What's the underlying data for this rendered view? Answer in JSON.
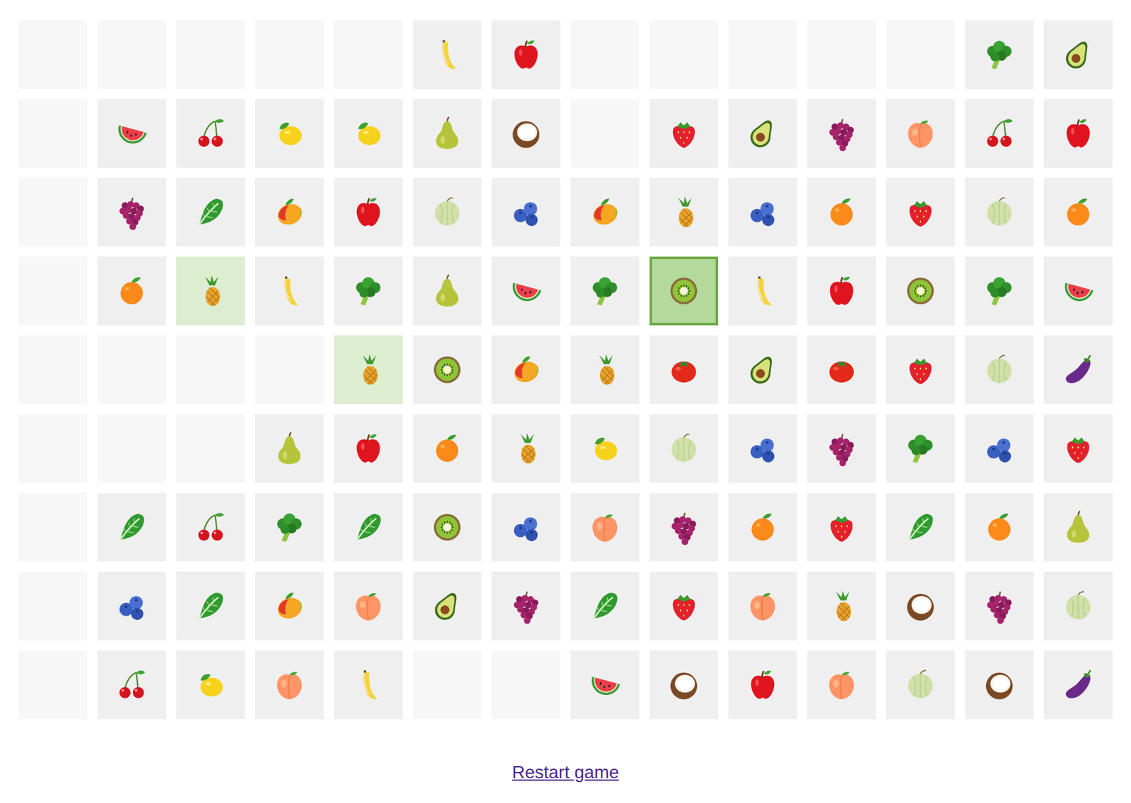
{
  "board": {
    "rows": [
      {
        "cells": [
          {
            "kind": "empty",
            "selected": false,
            "highlighted": false
          },
          {
            "kind": "empty",
            "selected": false,
            "highlighted": false
          },
          {
            "kind": "empty",
            "selected": false,
            "highlighted": false
          },
          {
            "kind": "empty",
            "selected": false,
            "highlighted": false
          },
          {
            "kind": "empty",
            "selected": false,
            "highlighted": false
          },
          {
            "kind": "banana",
            "selected": false,
            "highlighted": false
          },
          {
            "kind": "apple",
            "selected": false,
            "highlighted": false
          },
          {
            "kind": "empty",
            "selected": false,
            "highlighted": false
          },
          {
            "kind": "empty",
            "selected": false,
            "highlighted": false
          },
          {
            "kind": "empty",
            "selected": false,
            "highlighted": false
          },
          {
            "kind": "empty",
            "selected": false,
            "highlighted": false
          },
          {
            "kind": "empty",
            "selected": false,
            "highlighted": false
          },
          {
            "kind": "broccoli",
            "selected": false,
            "highlighted": false
          },
          {
            "kind": "avocado",
            "selected": false,
            "highlighted": false
          }
        ]
      },
      {
        "cells": [
          {
            "kind": "empty",
            "selected": false,
            "highlighted": false
          },
          {
            "kind": "watermelon",
            "selected": false,
            "highlighted": false
          },
          {
            "kind": "cherry",
            "selected": false,
            "highlighted": false
          },
          {
            "kind": "lemon",
            "selected": false,
            "highlighted": false
          },
          {
            "kind": "lemon",
            "selected": false,
            "highlighted": false
          },
          {
            "kind": "pear",
            "selected": false,
            "highlighted": false
          },
          {
            "kind": "coconut",
            "selected": false,
            "highlighted": false
          },
          {
            "kind": "empty",
            "selected": false,
            "highlighted": false
          },
          {
            "kind": "strawberry",
            "selected": false,
            "highlighted": false
          },
          {
            "kind": "avocado",
            "selected": false,
            "highlighted": false
          },
          {
            "kind": "grapes",
            "selected": false,
            "highlighted": false
          },
          {
            "kind": "peach",
            "selected": false,
            "highlighted": false
          },
          {
            "kind": "cherry",
            "selected": false,
            "highlighted": false
          },
          {
            "kind": "apple",
            "selected": false,
            "highlighted": false
          }
        ]
      },
      {
        "cells": [
          {
            "kind": "empty",
            "selected": false,
            "highlighted": false
          },
          {
            "kind": "grapes",
            "selected": false,
            "highlighted": false
          },
          {
            "kind": "lettuce",
            "selected": false,
            "highlighted": false
          },
          {
            "kind": "mango",
            "selected": false,
            "highlighted": false
          },
          {
            "kind": "apple",
            "selected": false,
            "highlighted": false
          },
          {
            "kind": "melon",
            "selected": false,
            "highlighted": false
          },
          {
            "kind": "blueberry",
            "selected": false,
            "highlighted": false
          },
          {
            "kind": "mango",
            "selected": false,
            "highlighted": false
          },
          {
            "kind": "pineapple",
            "selected": false,
            "highlighted": false
          },
          {
            "kind": "blueberry",
            "selected": false,
            "highlighted": false
          },
          {
            "kind": "orange",
            "selected": false,
            "highlighted": false
          },
          {
            "kind": "strawberry",
            "selected": false,
            "highlighted": false
          },
          {
            "kind": "melon",
            "selected": false,
            "highlighted": false
          },
          {
            "kind": "orange",
            "selected": false,
            "highlighted": false
          }
        ]
      },
      {
        "cells": [
          {
            "kind": "empty",
            "selected": false,
            "highlighted": false
          },
          {
            "kind": "orange",
            "selected": false,
            "highlighted": false
          },
          {
            "kind": "pineapple",
            "selected": false,
            "highlighted": true
          },
          {
            "kind": "banana",
            "selected": false,
            "highlighted": false
          },
          {
            "kind": "broccoli",
            "selected": false,
            "highlighted": false
          },
          {
            "kind": "pear",
            "selected": false,
            "highlighted": false
          },
          {
            "kind": "watermelon",
            "selected": false,
            "highlighted": false
          },
          {
            "kind": "broccoli",
            "selected": false,
            "highlighted": false
          },
          {
            "kind": "kiwi",
            "selected": true,
            "highlighted": false
          },
          {
            "kind": "banana",
            "selected": false,
            "highlighted": false
          },
          {
            "kind": "apple",
            "selected": false,
            "highlighted": false
          },
          {
            "kind": "kiwi",
            "selected": false,
            "highlighted": false
          },
          {
            "kind": "broccoli",
            "selected": false,
            "highlighted": false
          },
          {
            "kind": "watermelon",
            "selected": false,
            "highlighted": false
          }
        ]
      },
      {
        "cells": [
          {
            "kind": "empty",
            "selected": false,
            "highlighted": false
          },
          {
            "kind": "empty",
            "selected": false,
            "highlighted": false
          },
          {
            "kind": "empty",
            "selected": false,
            "highlighted": false
          },
          {
            "kind": "empty",
            "selected": false,
            "highlighted": false
          },
          {
            "kind": "pineapple",
            "selected": false,
            "highlighted": true
          },
          {
            "kind": "kiwi",
            "selected": false,
            "highlighted": false
          },
          {
            "kind": "mango",
            "selected": false,
            "highlighted": false
          },
          {
            "kind": "pineapple",
            "selected": false,
            "highlighted": false
          },
          {
            "kind": "tomato",
            "selected": false,
            "highlighted": false
          },
          {
            "kind": "avocado",
            "selected": false,
            "highlighted": false
          },
          {
            "kind": "tomato",
            "selected": false,
            "highlighted": false
          },
          {
            "kind": "strawberry",
            "selected": false,
            "highlighted": false
          },
          {
            "kind": "melon",
            "selected": false,
            "highlighted": false
          },
          {
            "kind": "eggplant",
            "selected": false,
            "highlighted": false
          }
        ]
      },
      {
        "cells": [
          {
            "kind": "empty",
            "selected": false,
            "highlighted": false
          },
          {
            "kind": "empty",
            "selected": false,
            "highlighted": false
          },
          {
            "kind": "empty",
            "selected": false,
            "highlighted": false
          },
          {
            "kind": "pear",
            "selected": false,
            "highlighted": false
          },
          {
            "kind": "apple",
            "selected": false,
            "highlighted": false
          },
          {
            "kind": "orange",
            "selected": false,
            "highlighted": false
          },
          {
            "kind": "pineapple",
            "selected": false,
            "highlighted": false
          },
          {
            "kind": "lemon",
            "selected": false,
            "highlighted": false
          },
          {
            "kind": "melon",
            "selected": false,
            "highlighted": false
          },
          {
            "kind": "blueberry",
            "selected": false,
            "highlighted": false
          },
          {
            "kind": "grapes",
            "selected": false,
            "highlighted": false
          },
          {
            "kind": "broccoli",
            "selected": false,
            "highlighted": false
          },
          {
            "kind": "blueberry",
            "selected": false,
            "highlighted": false
          },
          {
            "kind": "strawberry",
            "selected": false,
            "highlighted": false
          }
        ]
      },
      {
        "cells": [
          {
            "kind": "empty",
            "selected": false,
            "highlighted": false
          },
          {
            "kind": "lettuce",
            "selected": false,
            "highlighted": false
          },
          {
            "kind": "cherry",
            "selected": false,
            "highlighted": false
          },
          {
            "kind": "broccoli",
            "selected": false,
            "highlighted": false
          },
          {
            "kind": "lettuce",
            "selected": false,
            "highlighted": false
          },
          {
            "kind": "kiwi",
            "selected": false,
            "highlighted": false
          },
          {
            "kind": "blueberry",
            "selected": false,
            "highlighted": false
          },
          {
            "kind": "peach",
            "selected": false,
            "highlighted": false
          },
          {
            "kind": "grapes",
            "selected": false,
            "highlighted": false
          },
          {
            "kind": "orange",
            "selected": false,
            "highlighted": false
          },
          {
            "kind": "strawberry",
            "selected": false,
            "highlighted": false
          },
          {
            "kind": "lettuce",
            "selected": false,
            "highlighted": false
          },
          {
            "kind": "orange",
            "selected": false,
            "highlighted": false
          },
          {
            "kind": "pear",
            "selected": false,
            "highlighted": false
          }
        ]
      },
      {
        "cells": [
          {
            "kind": "empty",
            "selected": false,
            "highlighted": false
          },
          {
            "kind": "blueberry",
            "selected": false,
            "highlighted": false
          },
          {
            "kind": "lettuce",
            "selected": false,
            "highlighted": false
          },
          {
            "kind": "mango",
            "selected": false,
            "highlighted": false
          },
          {
            "kind": "peach",
            "selected": false,
            "highlighted": false
          },
          {
            "kind": "avocado",
            "selected": false,
            "highlighted": false
          },
          {
            "kind": "grapes",
            "selected": false,
            "highlighted": false
          },
          {
            "kind": "lettuce",
            "selected": false,
            "highlighted": false
          },
          {
            "kind": "strawberry",
            "selected": false,
            "highlighted": false
          },
          {
            "kind": "peach",
            "selected": false,
            "highlighted": false
          },
          {
            "kind": "pineapple",
            "selected": false,
            "highlighted": false
          },
          {
            "kind": "coconut",
            "selected": false,
            "highlighted": false
          },
          {
            "kind": "grapes",
            "selected": false,
            "highlighted": false
          },
          {
            "kind": "melon",
            "selected": false,
            "highlighted": false
          }
        ]
      },
      {
        "cells": [
          {
            "kind": "empty",
            "selected": false,
            "highlighted": false
          },
          {
            "kind": "cherry",
            "selected": false,
            "highlighted": false
          },
          {
            "kind": "lemon",
            "selected": false,
            "highlighted": false
          },
          {
            "kind": "peach",
            "selected": false,
            "highlighted": false
          },
          {
            "kind": "banana",
            "selected": false,
            "highlighted": false
          },
          {
            "kind": "empty",
            "selected": false,
            "highlighted": false
          },
          {
            "kind": "empty",
            "selected": false,
            "highlighted": false
          },
          {
            "kind": "watermelon",
            "selected": false,
            "highlighted": false
          },
          {
            "kind": "coconut",
            "selected": false,
            "highlighted": false
          },
          {
            "kind": "apple",
            "selected": false,
            "highlighted": false
          },
          {
            "kind": "peach",
            "selected": false,
            "highlighted": false
          },
          {
            "kind": "melon",
            "selected": false,
            "highlighted": false
          },
          {
            "kind": "coconut",
            "selected": false,
            "highlighted": false
          },
          {
            "kind": "eggplant",
            "selected": false,
            "highlighted": false
          }
        ]
      }
    ]
  },
  "restart": {
    "label": "Restart game"
  }
}
